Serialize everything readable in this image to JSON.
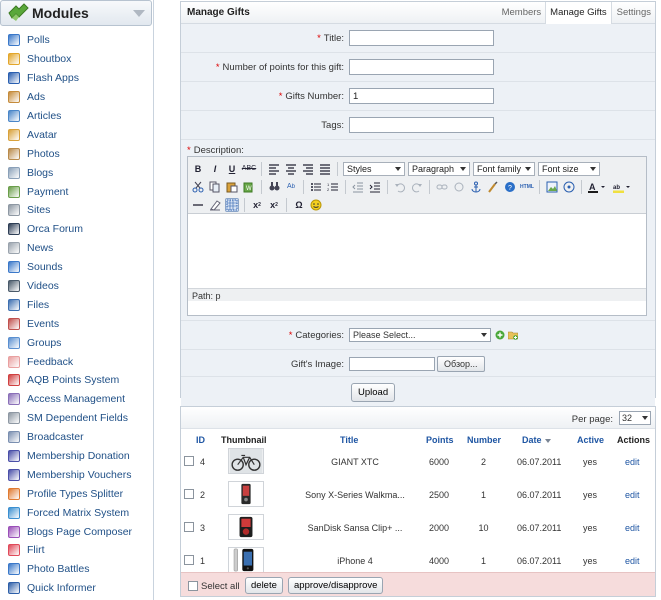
{
  "sidebar": {
    "title": "Modules",
    "items": [
      {
        "label": "Polls",
        "icon": "polls-icon",
        "color": "#3a78c9"
      },
      {
        "label": "Shoutbox",
        "icon": "shoutbox-icon",
        "color": "#e3a62a"
      },
      {
        "label": "Flash Apps",
        "icon": "flash-apps-icon",
        "color": "#2a5fb0"
      },
      {
        "label": "Ads",
        "icon": "ads-icon",
        "color": "#c58b3a"
      },
      {
        "label": "Articles",
        "icon": "articles-icon",
        "color": "#4a86c8"
      },
      {
        "label": "Avatar",
        "icon": "avatar-icon",
        "color": "#d9a13a"
      },
      {
        "label": "Photos",
        "icon": "photos-icon",
        "color": "#b98a4a"
      },
      {
        "label": "Blogs",
        "icon": "blogs-icon",
        "color": "#8aa0b8"
      },
      {
        "label": "Payment",
        "icon": "payment-icon",
        "color": "#6a9e4a"
      },
      {
        "label": "Sites",
        "icon": "sites-icon",
        "color": "#8e98a3"
      },
      {
        "label": "Orca Forum",
        "icon": "orca-forum-icon",
        "color": "#2e3e55"
      },
      {
        "label": "News",
        "icon": "news-icon",
        "color": "#9aa3ad"
      },
      {
        "label": "Sounds",
        "icon": "sounds-icon",
        "color": "#3a78c9"
      },
      {
        "label": "Videos",
        "icon": "videos-icon",
        "color": "#4a5a6a"
      },
      {
        "label": "Files",
        "icon": "files-icon",
        "color": "#3d6fb0"
      },
      {
        "label": "Events",
        "icon": "events-icon",
        "color": "#c0504d"
      },
      {
        "label": "Groups",
        "icon": "groups-icon",
        "color": "#5a8fd0"
      },
      {
        "label": "Feedback",
        "icon": "feedback-icon",
        "color": "#e9a0a0"
      },
      {
        "label": "AQB Points System",
        "icon": "points-system-icon",
        "color": "#d04040"
      },
      {
        "label": "Access Management",
        "icon": "access-management-icon",
        "color": "#8a6fb8"
      },
      {
        "label": "SM Dependent Fields",
        "icon": "dependent-fields-icon",
        "color": "#8e98a3"
      },
      {
        "label": "Broadcaster",
        "icon": "broadcaster-icon",
        "color": "#7a8fb0"
      },
      {
        "label": "Membership Donation",
        "icon": "membership-donation-icon",
        "color": "#4a4fa8"
      },
      {
        "label": "Membership Vouchers",
        "icon": "membership-vouchers-icon",
        "color": "#4a4fa8"
      },
      {
        "label": "Profile Types Splitter",
        "icon": "profile-types-splitter-icon",
        "color": "#e07a30"
      },
      {
        "label": "Forced Matrix System",
        "icon": "forced-matrix-icon",
        "color": "#3a8fd0"
      },
      {
        "label": "Blogs Page Composer",
        "icon": "blogs-page-composer-icon",
        "color": "#9a4fb8"
      },
      {
        "label": "Flirt",
        "icon": "flirt-icon",
        "color": "#e04a5a"
      },
      {
        "label": "Photo Battles",
        "icon": "photo-battles-icon",
        "color": "#3a78c9"
      },
      {
        "label": "Quick Informer",
        "icon": "quick-informer-icon",
        "color": "#2e5fa8"
      }
    ]
  },
  "manage": {
    "title": "Manage Gifts",
    "tabs": [
      "Members",
      "Manage Gifts",
      "Settings"
    ],
    "form": {
      "title_label": "Title:",
      "title_value": "",
      "points_label": "Number of points for this gift:",
      "points_value": "",
      "gifts_number_label": "Gifts Number:",
      "gifts_number_value": "1",
      "tags_label": "Tags:",
      "tags_value": "",
      "description_label": "Description:",
      "editor": {
        "styles": "Styles",
        "paragraph": "Paragraph",
        "font_family": "Font family",
        "font_size": "Font size",
        "path": "Path: p"
      },
      "categories_label": "Categories:",
      "categories_value": "Please Select...",
      "image_label": "Gift's Image:",
      "browse_label": "Обзор...",
      "upload_label": "Upload"
    }
  },
  "gifts": {
    "per_page_label": "Per page:",
    "per_page_value": "32",
    "headers": {
      "id": "ID",
      "thumbnail": "Thumbnail",
      "title": "Title",
      "points": "Points",
      "number": "Number",
      "date": "Date",
      "active": "Active",
      "actions": "Actions"
    },
    "rows": [
      {
        "id": "4",
        "thumb": "bicycle",
        "title": "GIANT XTC",
        "points": "6000",
        "number": "2",
        "date": "06.07.2011",
        "active": "yes",
        "action": "edit"
      },
      {
        "id": "2",
        "thumb": "phone-red",
        "title": "Sony X-Series Walkma...",
        "points": "2500",
        "number": "1",
        "date": "06.07.2011",
        "active": "yes",
        "action": "edit"
      },
      {
        "id": "3",
        "thumb": "player-red",
        "title": "SanDisk Sansa Clip+ ...",
        "points": "2000",
        "number": "10",
        "date": "06.07.2011",
        "active": "yes",
        "action": "edit"
      },
      {
        "id": "1",
        "thumb": "iphone",
        "title": "iPhone 4",
        "points": "4000",
        "number": "1",
        "date": "06.07.2011",
        "active": "yes",
        "action": "edit"
      }
    ],
    "footer": {
      "select_all": "Select all",
      "delete": "delete",
      "approve": "approve/disapprove"
    }
  }
}
